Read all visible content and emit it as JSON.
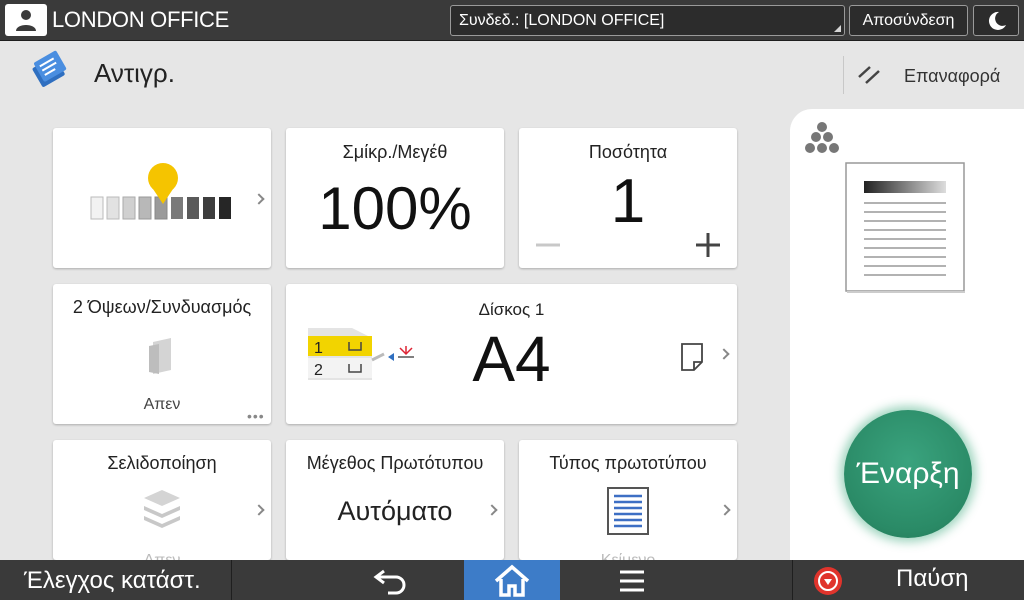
{
  "topbar": {
    "office_name": "LONDON OFFICE",
    "connection_value": "Συνδεδ.: [LONDON OFFICE]",
    "logout_label": "Αποσύνδεση"
  },
  "header": {
    "title": "Αντιγρ.",
    "reset_label": "Επαναφορά"
  },
  "tiles": {
    "density": {
      "level": 5,
      "steps": 9
    },
    "reduce_enlarge": {
      "title": "Σμίκρ./Μεγέθ",
      "value": "100%"
    },
    "quantity": {
      "title": "Ποσότητα",
      "value": "1"
    },
    "duplex": {
      "title": "2 Όψεων/Συνδυασμός",
      "value": "Απεν"
    },
    "tray": {
      "title": "Δίσκος 1",
      "value": "A4",
      "tray1": "1",
      "tray2": "2"
    },
    "pagination": {
      "title": "Σελιδοποίηση",
      "value": "Απεν"
    },
    "original_size": {
      "title": "Μέγεθος Πρωτότυπου",
      "value": "Αυτόματο"
    },
    "original_type": {
      "title": "Τύπος πρωτοτύπου",
      "value": "Κείμενο"
    }
  },
  "start_label": "Έναρξη",
  "bottombar": {
    "status_label": "Έλεγχος κατάστ.",
    "pause_label": "Παύση"
  },
  "colors": {
    "topbar_bg": "#3a3a3a",
    "home_active": "#3d7cc8",
    "start_green": "#2a8a66",
    "density_marker": "#f5c400",
    "tray_highlight": "#f2d400",
    "stop_red": "#e0342c"
  }
}
